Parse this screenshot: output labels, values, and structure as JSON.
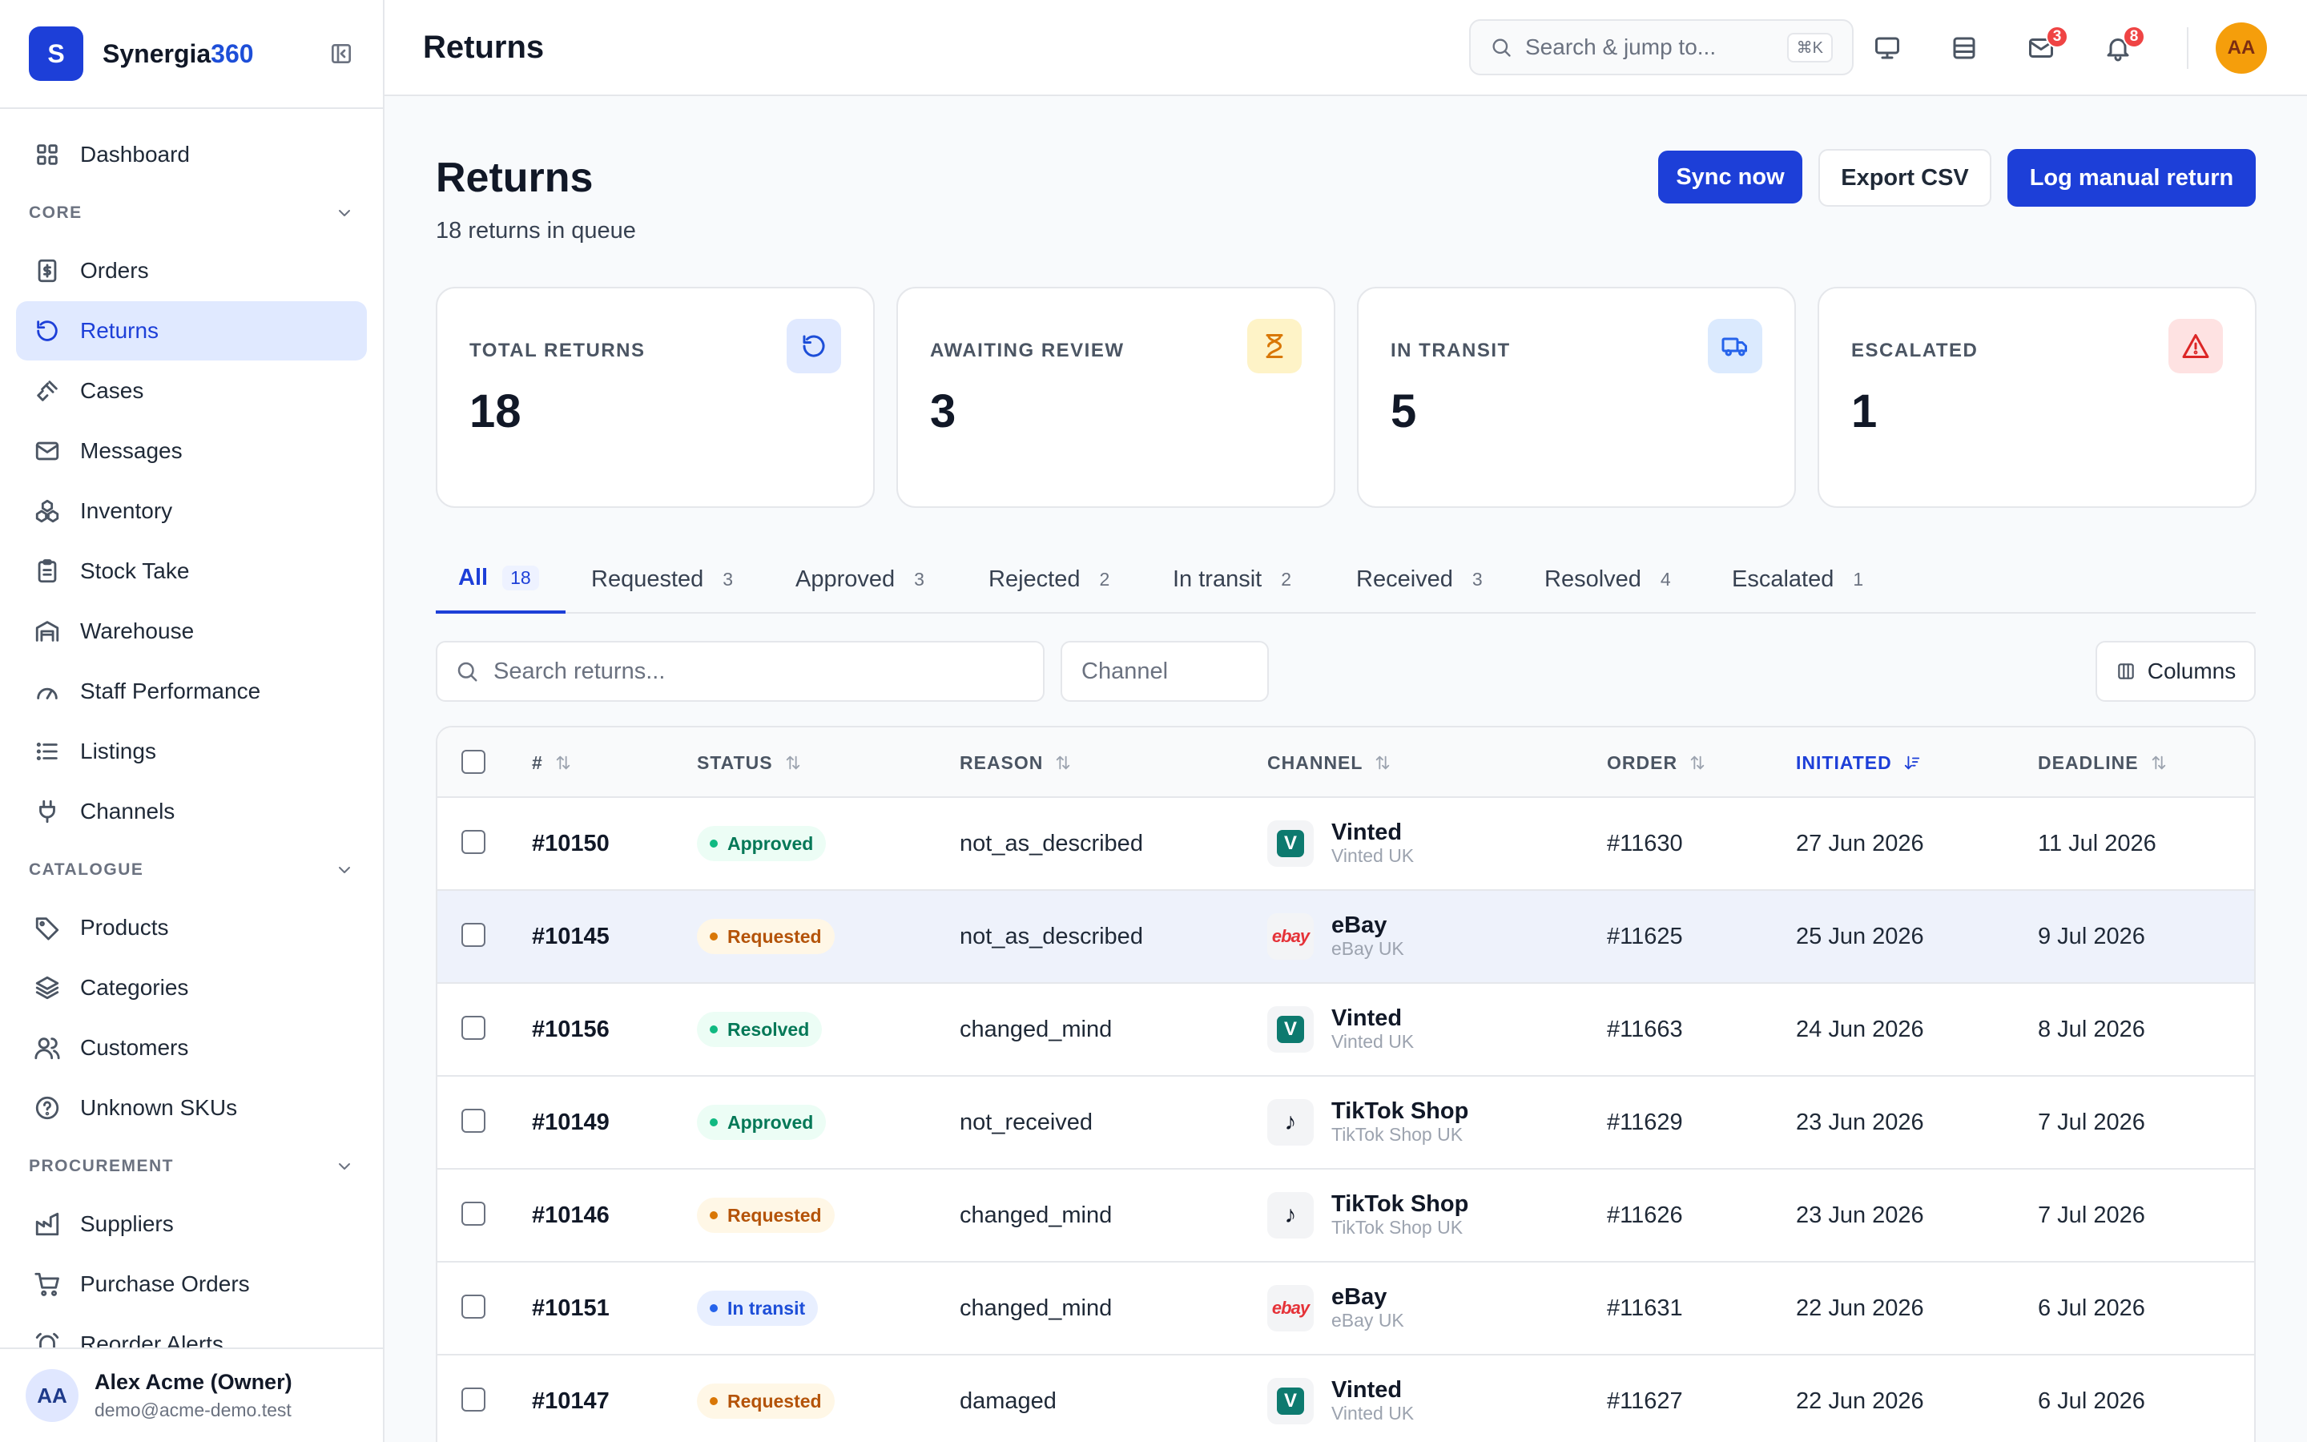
{
  "app": {
    "logo_letter": "S",
    "name_main": "Synergia",
    "name_accent": "360"
  },
  "sidebar": {
    "dashboard": "Dashboard",
    "sections": {
      "core": "CORE",
      "catalogue": "CATALOGUE",
      "procurement": "PROCUREMENT"
    },
    "core_items": [
      "Orders",
      "Returns",
      "Cases",
      "Messages",
      "Inventory",
      "Stock Take",
      "Warehouse",
      "Staff Performance",
      "Listings",
      "Channels"
    ],
    "catalogue_items": [
      "Products",
      "Categories",
      "Customers",
      "Unknown SKUs"
    ],
    "procurement_items": [
      "Suppliers",
      "Purchase Orders",
      "Reorder Alerts"
    ],
    "active_item": "Returns",
    "user": {
      "initials": "AA",
      "name": "Alex Acme (Owner)",
      "email": "demo@acme-demo.test"
    }
  },
  "topbar": {
    "title": "Returns",
    "search_placeholder": "Search & jump to...",
    "search_shortcut": "⌘K",
    "inbox_badge": "3",
    "notifications_badge": "8",
    "avatar_initials": "AA"
  },
  "page": {
    "title": "Returns",
    "subtitle": "18 returns in queue",
    "buttons": {
      "sync": "Sync now",
      "export": "Export CSV",
      "log": "Log manual return"
    }
  },
  "stats": [
    {
      "label": "TOTAL RETURNS",
      "value": "18",
      "icon": "refresh-icon",
      "color": "#1d4ed8",
      "bg": "#e0e9ff"
    },
    {
      "label": "AWAITING REVIEW",
      "value": "3",
      "icon": "hourglass-icon",
      "color": "#d97706",
      "bg": "#fef3c7"
    },
    {
      "label": "IN TRANSIT",
      "value": "5",
      "icon": "truck-icon",
      "color": "#2563eb",
      "bg": "#dbeafe"
    },
    {
      "label": "ESCALATED",
      "value": "1",
      "icon": "alert-triangle-icon",
      "color": "#dc2626",
      "bg": "#fee2e2"
    }
  ],
  "tabs": [
    {
      "label": "All",
      "count": "18"
    },
    {
      "label": "Requested",
      "count": "3"
    },
    {
      "label": "Approved",
      "count": "3"
    },
    {
      "label": "Rejected",
      "count": "2"
    },
    {
      "label": "In transit",
      "count": "2"
    },
    {
      "label": "Received",
      "count": "3"
    },
    {
      "label": "Resolved",
      "count": "4"
    },
    {
      "label": "Escalated",
      "count": "1"
    }
  ],
  "filters": {
    "search_placeholder": "Search returns...",
    "channel_placeholder": "Channel",
    "columns_label": "Columns"
  },
  "table": {
    "columns": [
      "#",
      "STATUS",
      "REASON",
      "CHANNEL",
      "ORDER",
      "INITIATED",
      "DEADLINE"
    ],
    "sorted_column": "INITIATED",
    "status_colors": {
      "Approved": {
        "fg": "#047857",
        "bg": "#ecfdf5",
        "dot": "#10b981"
      },
      "Requested": {
        "fg": "#b45309",
        "bg": "#fff7e6",
        "dot": "#d97706"
      },
      "Resolved": {
        "fg": "#047857",
        "bg": "#ecfdf5",
        "dot": "#10b981"
      },
      "In transit": {
        "fg": "#1d4ed8",
        "bg": "#e8efff",
        "dot": "#2563eb"
      }
    },
    "rows": [
      {
        "id": "#10150",
        "status": "Approved",
        "reason": "not_as_described",
        "channel": "Vinted",
        "channel_sub": "Vinted UK",
        "order": "#11630",
        "initiated": "27 Jun 2026",
        "deadline": "11 Jul 2026"
      },
      {
        "id": "#10145",
        "status": "Requested",
        "reason": "not_as_described",
        "channel": "eBay",
        "channel_sub": "eBay UK",
        "order": "#11625",
        "initiated": "25 Jun 2026",
        "deadline": "9 Jul 2026"
      },
      {
        "id": "#10156",
        "status": "Resolved",
        "reason": "changed_mind",
        "channel": "Vinted",
        "channel_sub": "Vinted UK",
        "order": "#11663",
        "initiated": "24 Jun 2026",
        "deadline": "8 Jul 2026"
      },
      {
        "id": "#10149",
        "status": "Approved",
        "reason": "not_received",
        "channel": "TikTok Shop",
        "channel_sub": "TikTok Shop UK",
        "order": "#11629",
        "initiated": "23 Jun 2026",
        "deadline": "7 Jul 2026"
      },
      {
        "id": "#10146",
        "status": "Requested",
        "reason": "changed_mind",
        "channel": "TikTok Shop",
        "channel_sub": "TikTok Shop UK",
        "order": "#11626",
        "initiated": "23 Jun 2026",
        "deadline": "7 Jul 2026"
      },
      {
        "id": "#10151",
        "status": "In transit",
        "reason": "changed_mind",
        "channel": "eBay",
        "channel_sub": "eBay UK",
        "order": "#11631",
        "initiated": "22 Jun 2026",
        "deadline": "6 Jul 2026"
      },
      {
        "id": "#10147",
        "status": "Requested",
        "reason": "damaged",
        "channel": "Vinted",
        "channel_sub": "Vinted UK",
        "order": "#11627",
        "initiated": "22 Jun 2026",
        "deadline": "6 Jul 2026"
      }
    ],
    "channel_logos": {
      "Vinted": {
        "text": "V",
        "color": "#0d7a6f"
      },
      "eBay": {
        "text": "ebay",
        "color": "#e53238"
      },
      "TikTok Shop": {
        "text": "♪",
        "color": "#111827"
      }
    }
  }
}
